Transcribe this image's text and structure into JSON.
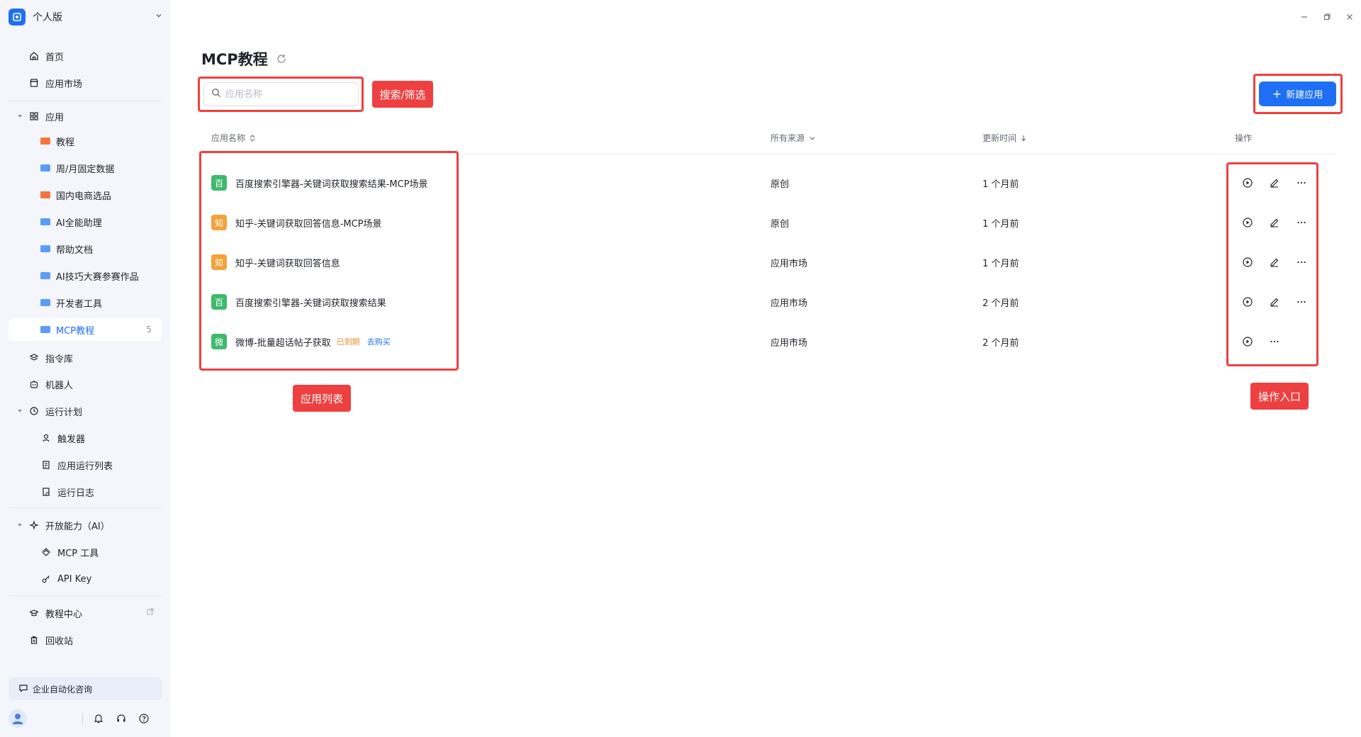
{
  "workspace": {
    "name": "个人版"
  },
  "sidebar": {
    "home": "首页",
    "market": "应用市场",
    "apps_group": "应用",
    "folders": [
      {
        "label": "教程",
        "color": "#f6743e"
      },
      {
        "label": "周/月固定数据",
        "color": "#5a9cf8"
      },
      {
        "label": "国内电商选品",
        "color": "#f6743e"
      },
      {
        "label": "AI全能助理",
        "color": "#5a9cf8"
      },
      {
        "label": "帮助文档",
        "color": "#5a9cf8"
      },
      {
        "label": "AI技巧大赛参赛作品",
        "color": "#5a9cf8"
      },
      {
        "label": "开发者工具",
        "color": "#5a9cf8"
      },
      {
        "label": "MCP教程",
        "color": "#5a9cf8",
        "count": "5",
        "selected": true
      }
    ],
    "commands": "指令库",
    "robots": "机器人",
    "schedule_group": "运行计划",
    "triggers": "触发器",
    "run_list": "应用运行列表",
    "run_log": "运行日志",
    "open_group": "开放能力（AI）",
    "mcp_tool": "MCP 工具",
    "api_key": "API Key",
    "tutorial_center": "教程中心",
    "recycle": "回收站",
    "consult": "企业自动化咨询"
  },
  "main": {
    "title": "MCP教程",
    "search_placeholder": "应用名称",
    "new_app": "新建应用",
    "columns": {
      "name": "应用名称",
      "source": "所有来源",
      "updated": "更新时间",
      "actions": "操作"
    },
    "rows": [
      {
        "icon": "百",
        "icon_color": "#3fba6c",
        "name": "百度搜索引擎器-关键词获取搜索结果-MCP场景",
        "source": "原创",
        "updated": "1 个月前",
        "editable": true
      },
      {
        "icon": "知",
        "icon_color": "#f5a23a",
        "name": "知乎-关键词获取回答信息-MCP场景",
        "source": "原创",
        "updated": "1 个月前",
        "editable": true
      },
      {
        "icon": "知",
        "icon_color": "#f5a23a",
        "name": "知乎-关键词获取回答信息",
        "source": "应用市场",
        "updated": "1 个月前",
        "editable": true
      },
      {
        "icon": "百",
        "icon_color": "#3fba6c",
        "name": "百度搜索引擎器-关键词获取搜索结果",
        "source": "应用市场",
        "updated": "2 个月前",
        "editable": true
      },
      {
        "icon": "微",
        "icon_color": "#3fba6c",
        "name": "微博-批量超话帖子获取",
        "source": "应用市场",
        "updated": "2 个月前",
        "editable": false,
        "expired": "已到期",
        "buy": "去购买"
      }
    ]
  },
  "annotations": {
    "search_filter": "搜索/筛选",
    "app_list": "应用列表",
    "action_entry": "操作入口"
  },
  "colors": {
    "primary": "#1e6ff5",
    "annotation": "#ee4040",
    "sidebar_bg": "#f4f6fb"
  }
}
